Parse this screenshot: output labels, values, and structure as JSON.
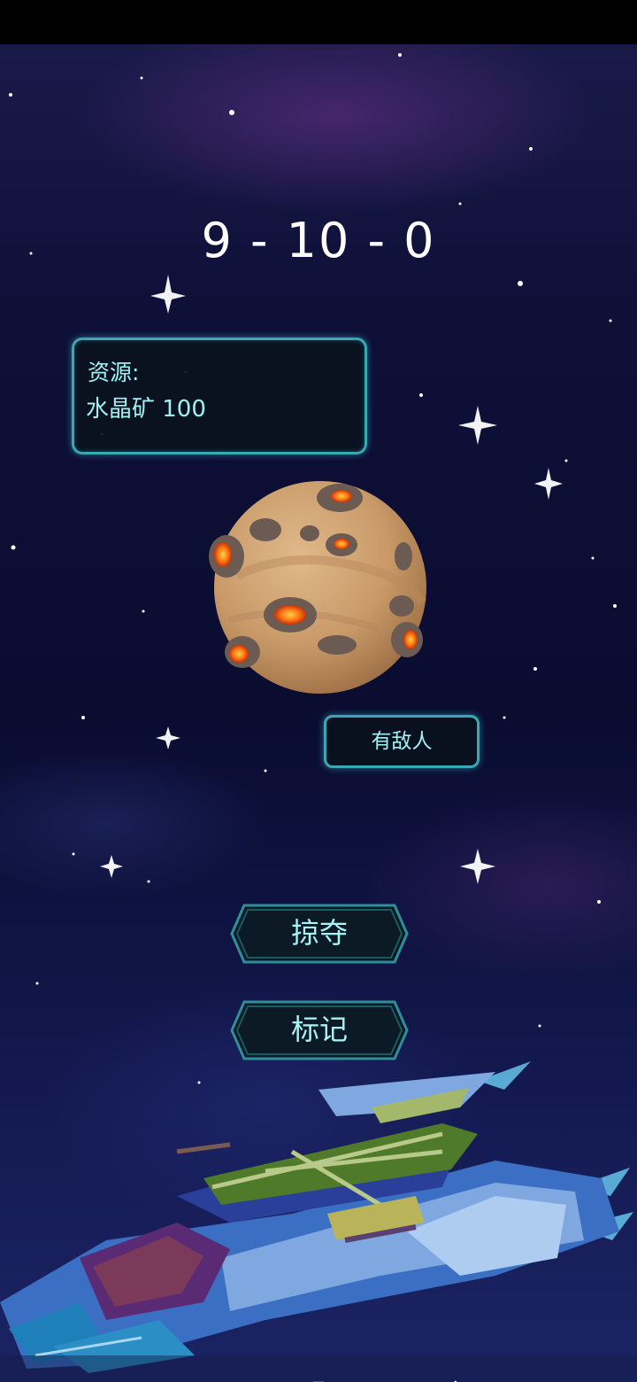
{
  "score": {
    "text": "9 - 10 - 0"
  },
  "resources": {
    "title": "资源:",
    "line": "水晶矿 100"
  },
  "planet": {
    "icon": "cratered-planet-icon"
  },
  "enemy_status": {
    "label": "有敌人"
  },
  "actions": {
    "plunder_label": "掠夺",
    "mark_label": "标记"
  },
  "ship": {
    "icon": "spaceship-icon"
  },
  "navigation": {
    "menu_icon": "menu-icon",
    "home_icon": "home-icon",
    "back_icon": "back-icon"
  },
  "colors": {
    "accent": "#3aa8b4",
    "text": "#9ff1f3",
    "background": "#0e1038"
  }
}
